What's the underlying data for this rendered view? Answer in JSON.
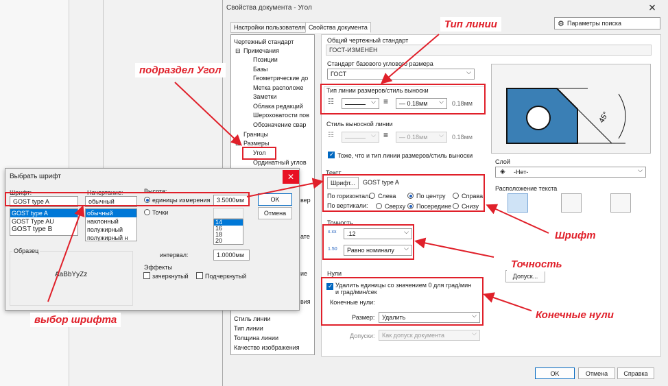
{
  "main_dialog": {
    "title": "Свойства документа - Угол",
    "tabs": [
      "Настройки пользователя",
      "Свойства документа"
    ],
    "search_placeholder": "Параметры поиска",
    "tree": [
      {
        "label": "Чертежный стандарт",
        "level": 0
      },
      {
        "label": "Примечания",
        "level": 1,
        "expander": "⊟"
      },
      {
        "label": "Позиции",
        "level": 2
      },
      {
        "label": "Базы",
        "level": 2
      },
      {
        "label": "Геометрические до",
        "level": 2
      },
      {
        "label": "Метка расположе",
        "level": 2
      },
      {
        "label": "Заметки",
        "level": 2
      },
      {
        "label": "Облака редакций",
        "level": 2
      },
      {
        "label": "Шероховатости пов",
        "level": 2
      },
      {
        "label": "Обозначение свар",
        "level": 2
      },
      {
        "label": "Границы",
        "level": 1
      },
      {
        "label": "Размеры",
        "level": 1,
        "expander": "⊟"
      },
      {
        "label": "Угол",
        "level": 2
      },
      {
        "label": "Ординатный углов",
        "level": 2
      }
    ],
    "tree_bottom": [
      "Стиль линии",
      "Тип линии",
      "Толщина линии",
      "Качество изображения"
    ],
    "overall_standard_label": "Общий чертежный стандарт",
    "overall_standard_value": "ГОСТ-ИЗМЕНЕН",
    "base_standard_label": "Стандарт базового углового размера",
    "base_standard_value": "ГОСТ",
    "line_style_label": "Тип линии размеров/стиль выноски",
    "line_thickness": "0.18мм",
    "line_thickness_value": "0.18мм",
    "leader_style_label": "Стиль выносной линии",
    "leader_thickness": "0.18мм",
    "leader_thickness_value": "0.18мм",
    "same_as_label": "Тоже, что и тип линии размеров/стиль выноски",
    "text_label": "Текст",
    "font_button": "Шрифт...",
    "font_name": "GOST type A",
    "horizontal_label": "По горизонтали:",
    "vertical_label": "По вертикали:",
    "h_options": [
      "Слева",
      "По центру",
      "Справа"
    ],
    "v_options": [
      "Сверху",
      "Посередине",
      "Снизу"
    ],
    "precision_label": "Точность",
    "precision_value": ".12",
    "precision_tol_value": "Равно номиналу",
    "precision_icon_1": "x.xx",
    "precision_icon_2": "1.50",
    "zeros_label": "Нули",
    "zeros_check_label": "Удалить единицы со значением 0 для град/мин и град/мин/сек",
    "trailing_zeros_label": "Конечные нули:",
    "size_label": "Размер:",
    "size_value": "Удалить",
    "tolerances_label": "Допуски:",
    "tolerances_value": "Как допуск документа",
    "layer_label": "Слой",
    "layer_value": "-Нет-",
    "text_position_label": "Расположение текста",
    "tolerance_button": "Допуск...",
    "ok": "OK",
    "cancel": "Отмена",
    "help": "Справка",
    "preview_angle": "45°"
  },
  "font_dialog": {
    "title": "Выбрать шрифт",
    "font_label": "Шрифт:",
    "font_value": "GOST type A",
    "fonts": [
      "GOST type A",
      "GOST Type AU",
      "GOST type B"
    ],
    "style_label": "Начертание:",
    "style_value": "обычный",
    "styles": [
      "обычный",
      "наклонный",
      "полужирный",
      "полужирный н"
    ],
    "height_label": "Высота:",
    "units_label": "единицы измерения",
    "units_value": "3.5000мм",
    "points_label": "Точки",
    "points": [
      "14",
      "16",
      "18",
      "20"
    ],
    "interval_label": "интервал:",
    "interval_value": "1.0000мм",
    "ok": "OK",
    "cancel": "Отмена",
    "sample_label": "Образец",
    "sample_text": "AaBbYyZz",
    "effects_label": "Эффекты",
    "strike_label": "зачеркнутый",
    "underline_label": "Подчеркнутый",
    "behind_text": [
      "вер",
      "ате",
      "ие",
      "вия"
    ]
  },
  "annotations": {
    "line_type": "Тип линии",
    "subsection": "подраздел Угол",
    "font": "Шрифт",
    "precision": "Точность",
    "trailing_zeros": "Конечные нули",
    "font_select": "выбор шрифта"
  },
  "colors": {
    "annotation_red": "#e0202a",
    "preview_fill": "#3a7fb5",
    "selection_blue": "#0078d7"
  }
}
